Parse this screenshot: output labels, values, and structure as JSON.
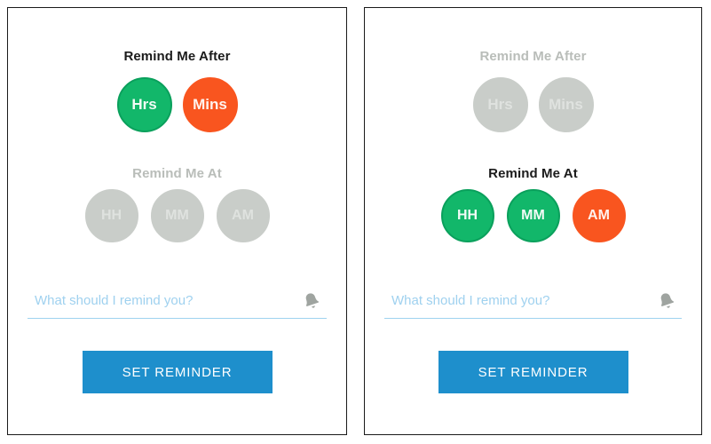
{
  "panels": [
    {
      "name": "left-panel",
      "after": {
        "title": "Remind Me After",
        "active": true,
        "options": [
          {
            "label": "Hrs",
            "state": "green"
          },
          {
            "label": "Mins",
            "state": "orange"
          }
        ]
      },
      "at": {
        "title": "Remind Me At",
        "active": false,
        "options": [
          {
            "label": "HH",
            "state": "muted"
          },
          {
            "label": "MM",
            "state": "muted"
          },
          {
            "label": "AM",
            "state": "muted"
          }
        ]
      },
      "input": {
        "placeholder": "What should I remind you?",
        "value": "",
        "icon": "bell-icon"
      },
      "submit_label": "SET REMINDER"
    },
    {
      "name": "right-panel",
      "after": {
        "title": "Remind Me After",
        "active": false,
        "options": [
          {
            "label": "Hrs",
            "state": "muted"
          },
          {
            "label": "Mins",
            "state": "muted"
          }
        ]
      },
      "at": {
        "title": "Remind Me At",
        "active": true,
        "options": [
          {
            "label": "HH",
            "state": "green"
          },
          {
            "label": "MM",
            "state": "green"
          },
          {
            "label": "AM",
            "state": "orange"
          }
        ]
      },
      "input": {
        "placeholder": "What should I remind you?",
        "value": "",
        "icon": "bell-icon"
      },
      "submit_label": "SET REMINDER"
    }
  ],
  "colors": {
    "green": "#12b76a",
    "orange": "#f9551f",
    "muted": "#c9cdc9",
    "button_blue": "#1e8fcc",
    "input_blue": "#9fd1ef",
    "title_active": "#1b1b1b",
    "title_inactive": "#b9bdb9"
  }
}
